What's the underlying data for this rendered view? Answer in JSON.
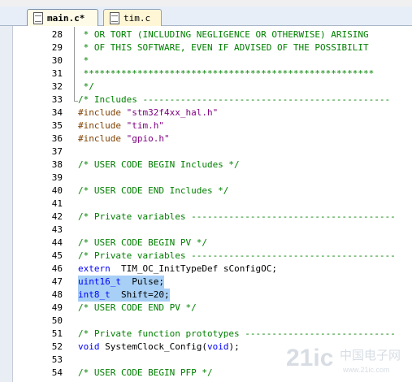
{
  "tabs": [
    {
      "label": "main.c*",
      "active": true
    },
    {
      "label": "tim.c",
      "active": false
    }
  ],
  "lines": [
    {
      "num": "28",
      "parts": [
        {
          "t": " * OR TORT (INCLUDING NEGLIGENCE OR OTHERWISE) ARISING",
          "c": "cm"
        }
      ]
    },
    {
      "num": "29",
      "parts": [
        {
          "t": " * OF THIS SOFTWARE, EVEN IF ADVISED OF THE POSSIBILIT",
          "c": "cm"
        }
      ]
    },
    {
      "num": "30",
      "parts": [
        {
          "t": " *",
          "c": "cm"
        }
      ]
    },
    {
      "num": "31",
      "parts": [
        {
          "t": " ******************************************************",
          "c": "cm"
        }
      ]
    },
    {
      "num": "32",
      "parts": [
        {
          "t": " */",
          "c": "cm"
        }
      ]
    },
    {
      "num": "33",
      "parts": [
        {
          "t": "/* Includes ----------------------------------------------",
          "c": "cm"
        }
      ]
    },
    {
      "num": "34",
      "parts": [
        {
          "t": "#include ",
          "c": "dir"
        },
        {
          "t": "\"stm32f4xx_hal.h\"",
          "c": "str"
        }
      ]
    },
    {
      "num": "35",
      "parts": [
        {
          "t": "#include ",
          "c": "dir"
        },
        {
          "t": "\"tim.h\"",
          "c": "str"
        }
      ]
    },
    {
      "num": "36",
      "parts": [
        {
          "t": "#include ",
          "c": "dir"
        },
        {
          "t": "\"gpio.h\"",
          "c": "str"
        }
      ]
    },
    {
      "num": "37",
      "parts": []
    },
    {
      "num": "38",
      "parts": [
        {
          "t": "/* USER CODE BEGIN Includes */",
          "c": "cm"
        }
      ]
    },
    {
      "num": "39",
      "parts": []
    },
    {
      "num": "40",
      "parts": [
        {
          "t": "/* USER CODE END Includes */",
          "c": "cm"
        }
      ]
    },
    {
      "num": "41",
      "parts": []
    },
    {
      "num": "42",
      "parts": [
        {
          "t": "/* Private variables --------------------------------------",
          "c": "cm"
        }
      ]
    },
    {
      "num": "43",
      "parts": []
    },
    {
      "num": "44",
      "parts": [
        {
          "t": "/* USER CODE BEGIN PV */",
          "c": "cm"
        }
      ]
    },
    {
      "num": "45",
      "parts": [
        {
          "t": "/* Private variables --------------------------------------",
          "c": "cm"
        }
      ]
    },
    {
      "num": "46",
      "parts": [
        {
          "t": "extern",
          "c": "kw"
        },
        {
          "t": "  TIM_OC_InitTypeDef sConfigOC;",
          "c": ""
        }
      ]
    },
    {
      "num": "47",
      "parts": [
        {
          "t": "uint16_t",
          "c": "kw"
        },
        {
          "t": "  Pulse;",
          "c": ""
        }
      ],
      "highlight": true
    },
    {
      "num": "48",
      "parts": [
        {
          "t": "int8_t",
          "c": "kw"
        },
        {
          "t": "  Shift=20;",
          "c": ""
        }
      ],
      "highlight": true
    },
    {
      "num": "49",
      "parts": [
        {
          "t": "/* USER CODE END PV */",
          "c": "cm"
        }
      ]
    },
    {
      "num": "50",
      "parts": []
    },
    {
      "num": "51",
      "parts": [
        {
          "t": "/* Private function prototypes ----------------------------",
          "c": "cm"
        }
      ]
    },
    {
      "num": "52",
      "parts": [
        {
          "t": "void",
          "c": "kw"
        },
        {
          "t": " SystemClock_Config(",
          "c": ""
        },
        {
          "t": "void",
          "c": "kw"
        },
        {
          "t": ");",
          "c": ""
        }
      ]
    },
    {
      "num": "53",
      "parts": []
    },
    {
      "num": "54",
      "parts": [
        {
          "t": "/* USER CODE BEGIN PFP */",
          "c": "cm"
        }
      ]
    }
  ],
  "watermark": {
    "brand": "21ic",
    "cn": "中国电子网",
    "site": "www.21ic.com"
  },
  "colors": {
    "comment": "#008000",
    "directive": "#804000",
    "string": "#800080",
    "keyword": "#0000ff",
    "selection": "#a8cff5"
  }
}
